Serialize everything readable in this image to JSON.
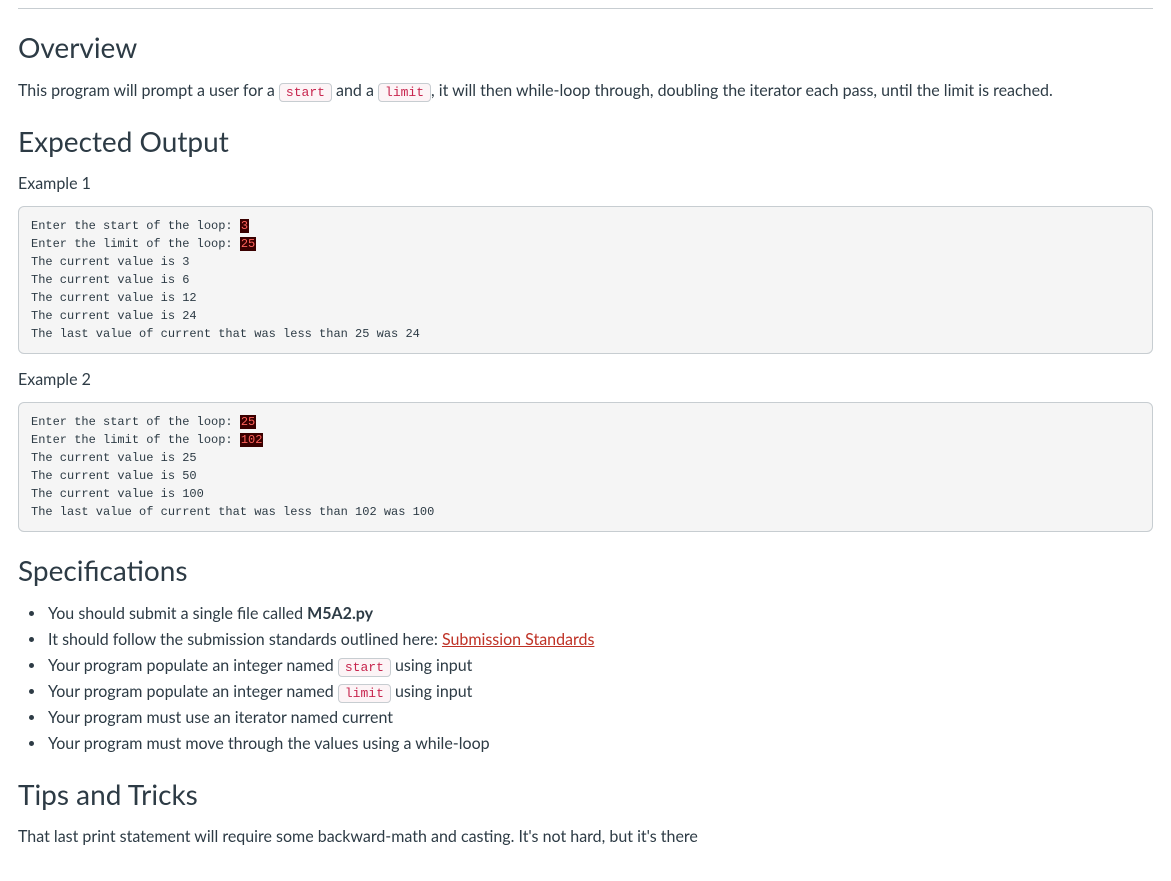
{
  "overview": {
    "heading": "Overview",
    "intro_before_code1": "This program will prompt a user for a ",
    "code1": "start",
    "intro_mid": " and a ",
    "code2": "limit",
    "intro_after": ", it will then while-loop through, doubling the iterator each pass, until the limit is reached."
  },
  "expected_output": {
    "heading": "Expected Output",
    "example1_label": "Example 1",
    "example1_line1_text": "Enter the start of the loop: ",
    "example1_line1_hl": "3",
    "example1_line2_text": "Enter the limit of the loop: ",
    "example1_line2_hl": "25",
    "example1_rest": "\nThe current value is 3\nThe current value is 6\nThe current value is 12\nThe current value is 24\nThe last value of current that was less than 25 was 24",
    "example2_label": "Example 2",
    "example2_line1_text": "Enter the start of the loop: ",
    "example2_line1_hl": "25",
    "example2_line2_text": "Enter the limit of the loop: ",
    "example2_line2_hl": "102",
    "example2_rest": "\nThe current value is 25\nThe current value is 50\nThe current value is 100\nThe last value of current that was less than 102 was 100"
  },
  "specs": {
    "heading": "Specifications",
    "item1_before": "You should submit a single file called ",
    "item1_bold": "M5A2.py",
    "item2_before": "It should follow the submission standards outlined here: ",
    "item2_link": "Submission Standards",
    "item3_before": "Your program populate an integer named ",
    "item3_code": "start",
    "item3_after": " using input",
    "item4_before": "Your program populate an integer named ",
    "item4_code": "limit",
    "item4_after": " using input",
    "item5": "Your program must use an iterator named current",
    "item6": "Your program must move through the values using a while-loop"
  },
  "tips": {
    "heading": "Tips and Tricks",
    "text": "That last print statement will require some backward-math and casting.  It's not hard, but it's there"
  }
}
